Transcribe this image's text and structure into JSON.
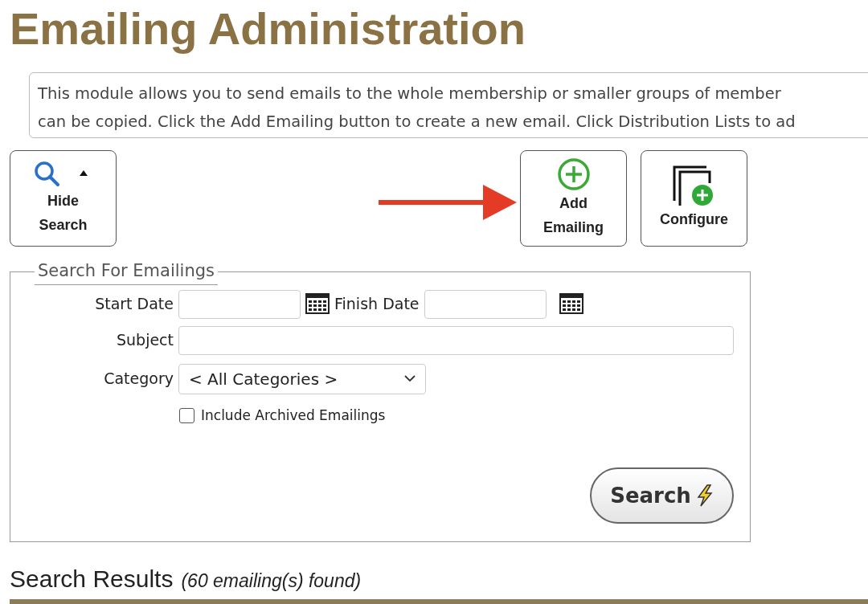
{
  "title": "Emailing Administration",
  "description": [
    "This module allows you to send emails to the whole membership or smaller groups of member",
    "can be copied. Click the Add Emailing button to create a new email. Click Distribution Lists to ad"
  ],
  "toolbar": [
    {
      "kind": "hide-search",
      "label": [
        "Hide",
        "Search"
      ]
    },
    {
      "kind": "add",
      "label": [
        "Add",
        "Emailing"
      ]
    },
    {
      "kind": "configure",
      "label": [
        "Configure"
      ]
    }
  ],
  "search_form": {
    "legend": "Search For Emailings",
    "start_date": {
      "label": "Start Date"
    },
    "finish_date": {
      "label": "Finish Date"
    },
    "subject": {
      "label": "Subject"
    },
    "category": {
      "label": "Category",
      "value": "< All Categories >"
    },
    "archived": {
      "label": "Include Archived Emailings",
      "checked": false
    },
    "button": "Search"
  },
  "results": {
    "title": "Search Results",
    "count": "(60 emailing(s) found)"
  }
}
